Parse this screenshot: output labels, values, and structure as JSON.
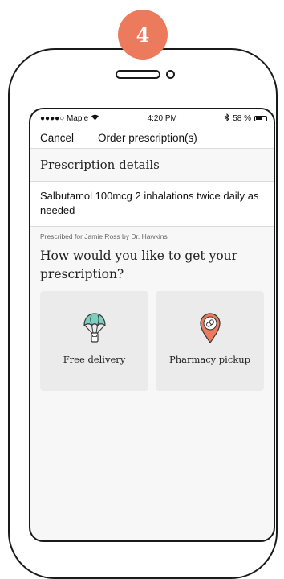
{
  "step": {
    "number": "4",
    "color": "#ec7b5d"
  },
  "status_bar": {
    "carrier": "●●●●○ Maple",
    "time": "4:20 PM",
    "battery_text": "58 %",
    "battery_level": 0.58
  },
  "nav": {
    "cancel_label": "Cancel",
    "title": "Order prescription(s)"
  },
  "details": {
    "header": "Prescription details",
    "medication": "Salbutamol 100mcg 2 inhalations twice daily as needed",
    "prescribed_by": "Prescribed for Jamie Ross by Dr. Hawkins"
  },
  "question": "How would you like to get your prescription?",
  "options": [
    {
      "label": "Free delivery",
      "icon": "parachute-package-icon",
      "icon_color": "#7ccfbf"
    },
    {
      "label": "Pharmacy pickup",
      "icon": "map-pin-pill-icon",
      "icon_color": "#ec7b5d"
    }
  ]
}
